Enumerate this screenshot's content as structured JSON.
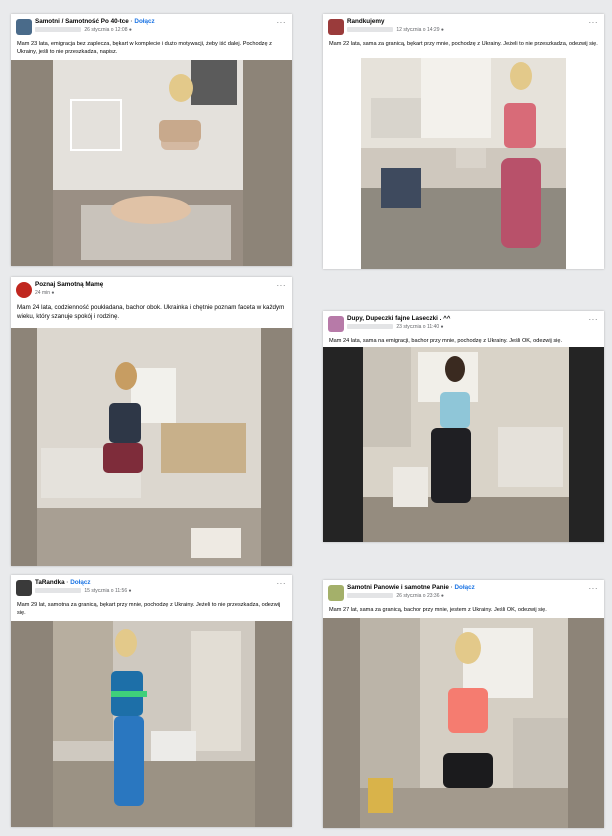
{
  "posts": [
    {
      "group": "Samotni / Samotność Po 40-tce",
      "join": "Dołącz",
      "time": "26 stycznia o 12:08",
      "text": "Mam 23 lata, emigracja bez zaplecza, bękart w komplecie i dużo motywacji, żeby iść dalej. Pochodzę z Ukrainy, jeśli to nie przeszkadza, napisz.",
      "avatar_color": "#4a6b8a",
      "more": "···"
    },
    {
      "group": "Randkujemy",
      "join": "",
      "time": "12 stycznia o 14:29",
      "text": "Mam 22 lata, sama za granicą, bękart przy mnie, pochodzę z Ukrainy. Jeżeli to nie przeszkadza, odezwij się.",
      "avatar_color": "#9a3b3b",
      "more": "···"
    },
    {
      "group": "Poznaj Samotną Mamę",
      "join": "",
      "time": "24 min",
      "text": "Mam 24 lata, codzienność poukładana, bachor obok. Ukrainka i chętnie poznam faceta w każdym wieku, który szanuje spokój i rodzinę.",
      "avatar_color": "#c0271f",
      "more": "···"
    },
    {
      "group": "Dupy, Dupeczki fajne Laseczki . ^^",
      "join": "",
      "time": "23 stycznia o 11:40",
      "text": "Mam 24 lata, sama na emigracji, bachor przy mnie, pochodzę z Ukrainy. Jeśli OK, odezwij się.",
      "avatar_color": "#b77aa8",
      "more": "···"
    },
    {
      "group": "TaRandka",
      "join": "Dołącz",
      "time": "15 stycznia o 11:56",
      "text": "Mam 29 lat, samotna za granicą, bękart przy mnie, pochodzę z Ukrainy. Jeżeli to nie przeszkadza, odezwij się.",
      "avatar_color": "#3a3a3a",
      "more": "···"
    },
    {
      "group": "Samotni Panowie i samotne Panie",
      "join": "Dołącz",
      "time": "26 stycznia o 23:36",
      "text": "Mam 27 lat, sama za granicą, bachor przy mnie, jestem z Ukrainy. Jeśli OK, odezwij się.",
      "avatar_color": "#a4b06a",
      "more": "···"
    }
  ]
}
